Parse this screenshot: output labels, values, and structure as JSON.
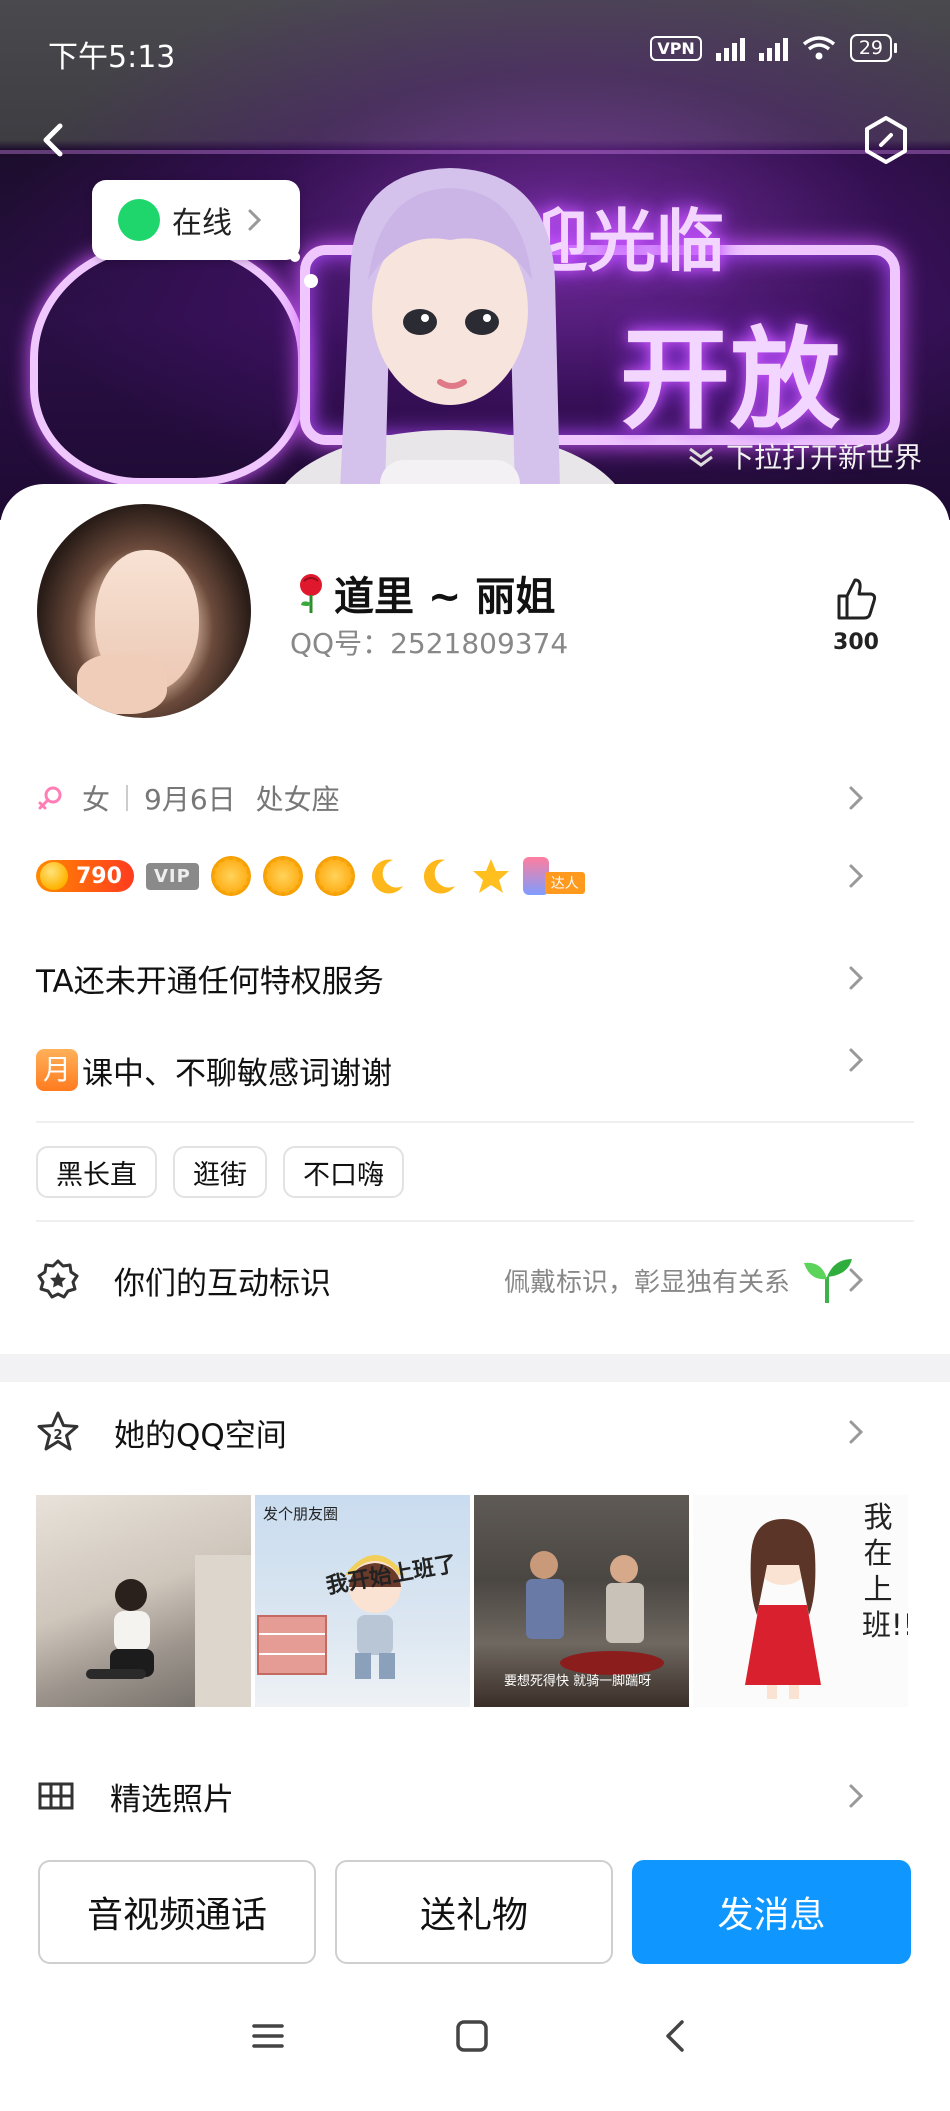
{
  "status_bar": {
    "time": "下午5:13",
    "vpn": "VPN",
    "battery": "29"
  },
  "header": {
    "online_status": "在线",
    "pull_hint": "下拉打开新世界",
    "neon_text_top": "迎光临",
    "neon_text_main": "开放"
  },
  "profile": {
    "nickname": "道里 ~ 丽姐",
    "qq_id": "QQ号：2521809374",
    "likes": "300",
    "gender": "女",
    "birthday": "9月6日",
    "zodiac": "处女座",
    "coin_value": "790",
    "vip_label": "VIP",
    "talent_tag": "达人",
    "privilege_text": "TA还未开通任何特权服务",
    "month_badge": "月",
    "signature": "课中、不聊敏感词谢谢",
    "tags": [
      "黑长直",
      "逛街",
      "不口嗨"
    ]
  },
  "interaction": {
    "label": "你们的互动标识",
    "hint": "佩戴标识，彰显独有关系"
  },
  "qzone": {
    "label": "她的QQ空间",
    "photo2_label": "发个朋友圈",
    "photo2_text": "我开始上班了",
    "photo3_caption": "要想死得快 就骑一脚踹呀",
    "photo4_text": "我在上班!!!"
  },
  "featured": {
    "label": "精选照片"
  },
  "actions": {
    "call": "音视频通话",
    "gift": "送礼物",
    "message": "发消息"
  },
  "colors": {
    "primary": "#0f97ff",
    "online": "#1ed66b",
    "coin": "#ff5a1f"
  }
}
